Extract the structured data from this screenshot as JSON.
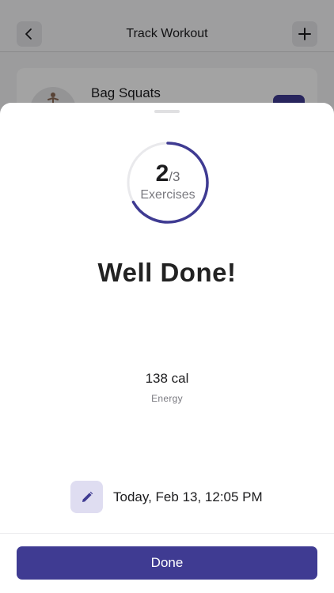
{
  "background": {
    "header": {
      "title": "Track Workout",
      "back_icon": "chevron-left-icon",
      "add_icon": "plus-icon"
    },
    "exercise_card": {
      "name": "Bag Squats",
      "avatar_icon": "person-figure-icon"
    }
  },
  "sheet": {
    "progress": {
      "done": "2",
      "total": "/3",
      "label": "Exercises",
      "fraction": 0.667
    },
    "headline": "Well Done!",
    "energy": {
      "value": "138 cal",
      "label": "Energy"
    },
    "date": {
      "edit_icon": "pencil-icon",
      "text": "Today, Feb 13, 12:05 PM"
    },
    "done_label": "Done"
  },
  "colors": {
    "accent": "#3f3b92",
    "accent_light": "#dfddf1",
    "ring_track": "#e9e9ec"
  }
}
